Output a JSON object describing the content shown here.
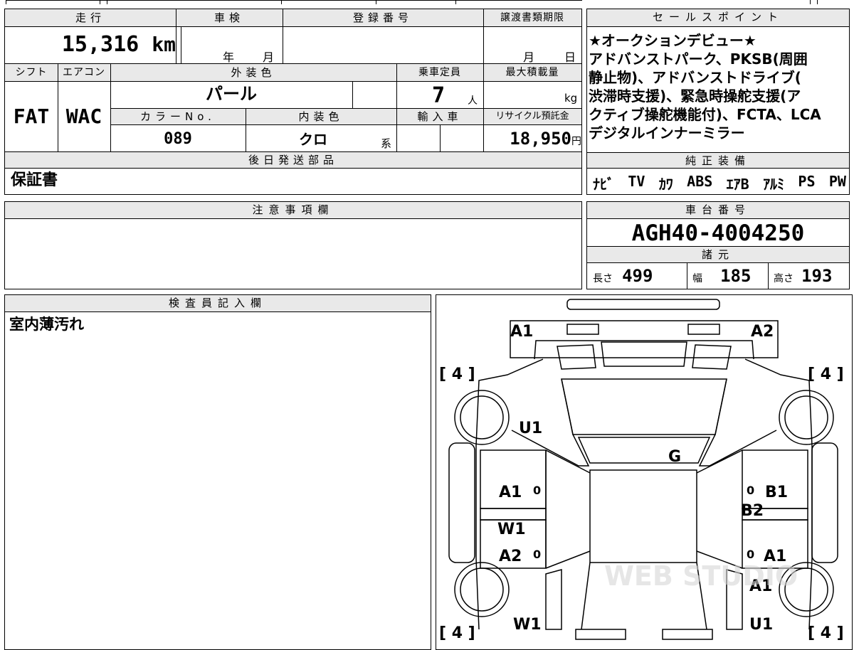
{
  "grid": {
    "mileage_label": "走行",
    "mileage_value": "15,316",
    "mileage_unit": "km",
    "shaken_label": "車検",
    "shaken_year": "年",
    "shaken_month": "月",
    "reg_number_label": "登録番号",
    "transfer_deadline_label": "譲渡書類期限",
    "transfer_month": "月",
    "transfer_day": "日",
    "shift_label": "シフト",
    "shift_value": "FAT",
    "ac_label": "エアコン",
    "ac_value": "WAC",
    "exterior_color_label": "外装色",
    "exterior_color_value": "パール",
    "capacity_label": "乗車定員",
    "capacity_value": "7",
    "capacity_unit": "人",
    "max_load_label": "最大積載量",
    "max_load_unit": "kg",
    "color_no_label": "カラーNo.",
    "color_no_value": "089",
    "interior_color_label": "内装色",
    "interior_color_value": "クロ",
    "interior_color_suffix": "系",
    "import_label": "輸入車",
    "recycle_label": "リサイクル預託金",
    "recycle_value": "18,950",
    "recycle_unit": "円",
    "later_parts_label": "後日発送部品",
    "later_parts_value": "保証書"
  },
  "sales_points": {
    "label": "セールスポイント",
    "lines": [
      "★オークションデビュー★",
      "アドバンストパーク、PKSB(周囲",
      "静止物)、アドバンストドライブ(",
      "渋滞時支援)、緊急時操舵支援(ア",
      "クティブ操舵機能付)、FCTA、LCA",
      "デジタルインナーミラー"
    ]
  },
  "equipment": {
    "label": "純正装備",
    "items": [
      "ﾅﾋﾞ",
      "TV",
      "ｶﾜ",
      "ABS",
      "ｴｱB",
      "ｱﾙﾐ",
      "PS",
      "PW"
    ]
  },
  "notes": {
    "label": "注意事項欄",
    "value": ""
  },
  "chassis": {
    "label": "車台番号",
    "value": "AGH40-4004250"
  },
  "specs": {
    "label": "諸元",
    "length_label": "長さ",
    "length_value": "499",
    "width_label": "幅",
    "width_value": "185",
    "height_label": "高さ",
    "height_value": "193"
  },
  "inspector": {
    "label": "検査員記入欄",
    "comment": "室内薄汚れ"
  },
  "diagram": {
    "marks": {
      "front_left": "A1",
      "front_right": "A2",
      "tire_fl": "[ 4 ]",
      "tire_fr": "[ 4 ]",
      "tire_rl": "[ 4 ]",
      "tire_rr": "[ 4 ]",
      "fender_left": "U1",
      "windshield": "G",
      "door_fl": "A1",
      "door_fl_zero": "0",
      "sill_left": "W1",
      "door_rl": "A2",
      "door_rl_zero": "0",
      "door_fr": "B1",
      "door_fr_zero": "0",
      "pillar_right": "B2",
      "door_rr": "A1",
      "door_rr_zero": "0",
      "quarter_right": "A1",
      "rear_left": "W1",
      "rear_right": "U1"
    },
    "watermark": "WEB STUDIO"
  }
}
